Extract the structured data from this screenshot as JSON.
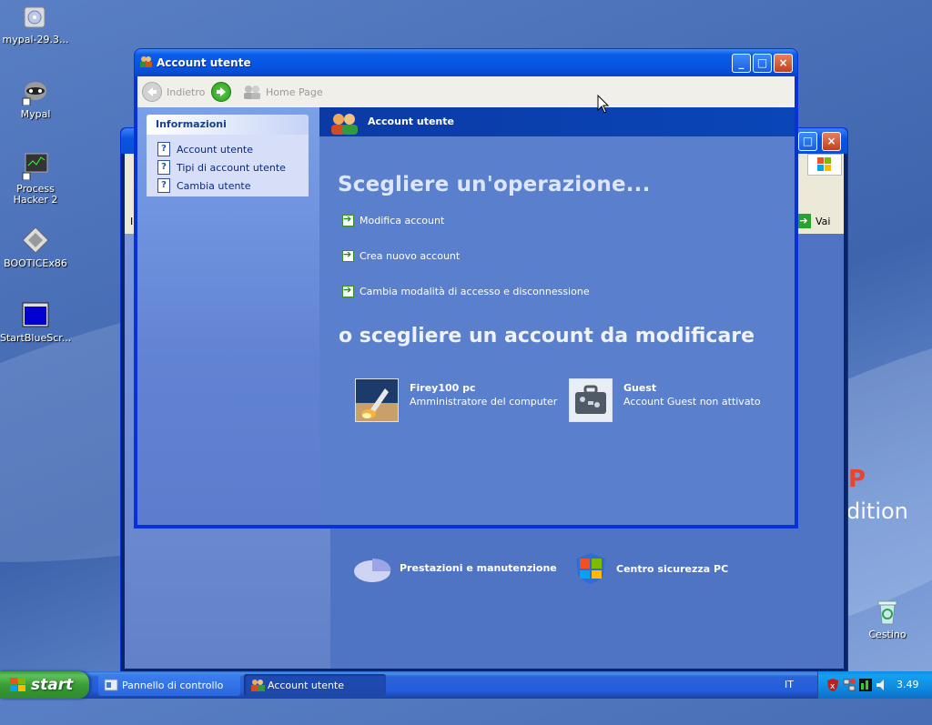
{
  "desktop": {
    "icons": [
      {
        "label": "mypal-29.3..."
      },
      {
        "label": "Mypal"
      },
      {
        "label": "Process Hacker 2"
      },
      {
        "label": "BOOTICEx86"
      },
      {
        "label": "StartBlueScr..."
      },
      {
        "label": "Cestino"
      }
    ],
    "edition_text": "dition",
    "logo_fragment": "P"
  },
  "background_window": {
    "address_go_label": "Vai",
    "address_left_fragment": "I",
    "category_1": "Prestazioni e manutenzione",
    "category_2": "Centro sicurezza PC"
  },
  "window": {
    "title": "Account utente",
    "toolbar": {
      "back_label": "Indietro",
      "home_label": "Home Page"
    },
    "taskpane": {
      "header": "Informazioni",
      "links": [
        "Account utente",
        "Tipi di account utente",
        "Cambia utente"
      ]
    },
    "banner_title": "Account utente",
    "heading_task": "Scegliere un'operazione...",
    "tasks": [
      "Modifica account",
      "Crea nuovo account",
      "Cambia modalità di accesso e disconnessione"
    ],
    "heading_account": "o scegliere un account da modificare",
    "accounts": [
      {
        "name": "Firey100 pc",
        "desc": "Amministratore del computer"
      },
      {
        "name": "Guest",
        "desc": "Account Guest non attivato"
      }
    ]
  },
  "taskbar": {
    "start_label": "start",
    "items": [
      "Pannello di controllo",
      "Account utente"
    ],
    "language": "IT",
    "clock": "3.49"
  },
  "colors": {
    "accent_blue": "#0a54e0",
    "start_green": "#3a9c37",
    "close_red": "#c1401c"
  }
}
